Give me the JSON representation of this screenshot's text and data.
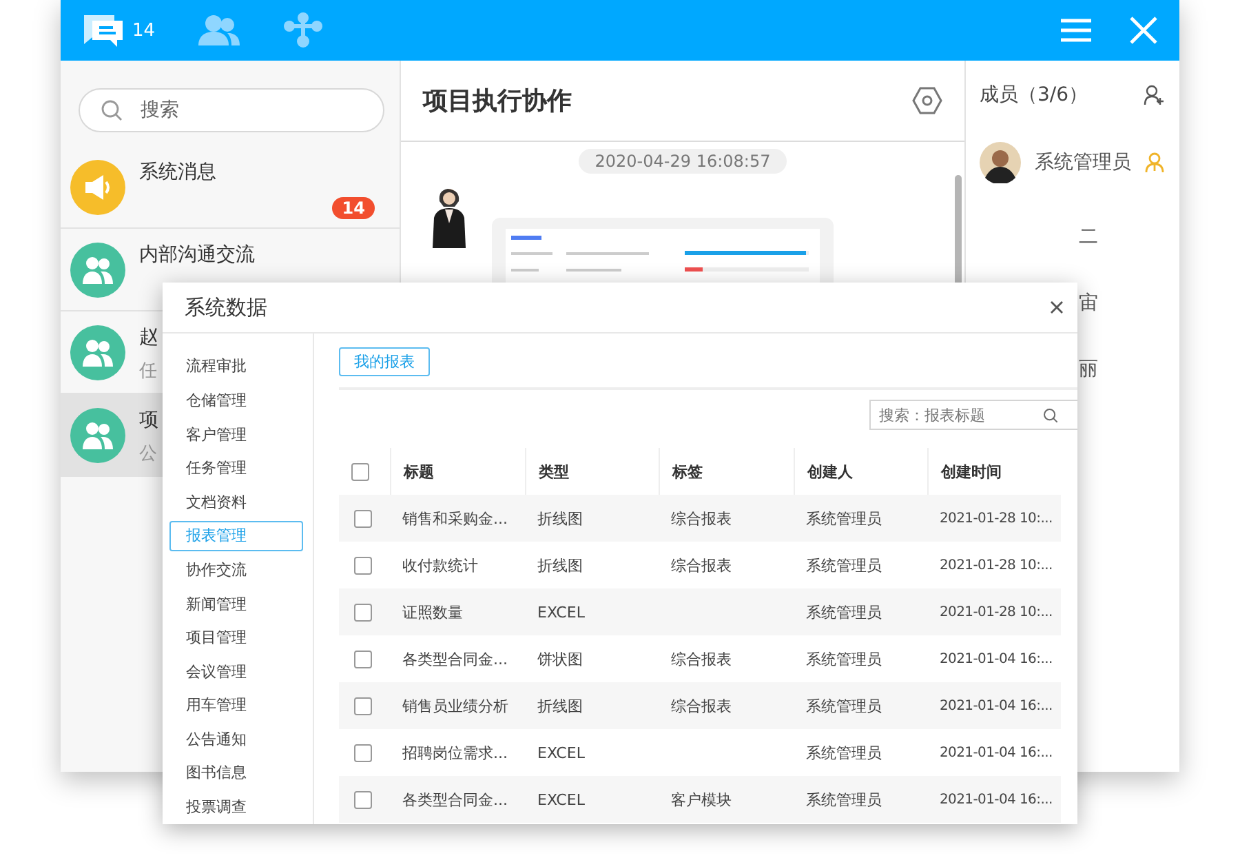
{
  "topbar": {
    "tabs": [
      {
        "kind": "chat",
        "count": "14",
        "selected": true
      },
      {
        "kind": "contacts",
        "selected": false
      },
      {
        "kind": "org",
        "selected": false
      }
    ]
  },
  "search": {
    "placeholder": "搜索"
  },
  "conversations": [
    {
      "kind": "system",
      "name": "系统消息",
      "badge": "14",
      "selected": false
    },
    {
      "kind": "group",
      "name": "内部沟通交流",
      "selected": false
    },
    {
      "kind": "group",
      "name": "赵",
      "preview": "任",
      "selected": false
    },
    {
      "kind": "group",
      "name": "项",
      "preview": "公",
      "selected": true
    }
  ],
  "chat": {
    "title": "项目执行协作",
    "timestamp": "2020-04-29 16:08:57"
  },
  "members": {
    "title": "成员（3/6）",
    "list": [
      {
        "kind": "full",
        "name": "系统管理员",
        "admin": true
      },
      {
        "kind": "cut",
        "name": "二"
      },
      {
        "kind": "cut",
        "name": "宙"
      },
      {
        "kind": "cut",
        "name": "丽"
      }
    ]
  },
  "dialog": {
    "title": "系统数据",
    "nav": [
      {
        "label": "流程审批",
        "selected": false
      },
      {
        "label": "仓储管理",
        "selected": false
      },
      {
        "label": "客户管理",
        "selected": false
      },
      {
        "label": "任务管理",
        "selected": false
      },
      {
        "label": "文档资料",
        "selected": false
      },
      {
        "label": "报表管理",
        "selected": true
      },
      {
        "label": "协作交流",
        "selected": false
      },
      {
        "label": "新闻管理",
        "selected": false
      },
      {
        "label": "项目管理",
        "selected": false
      },
      {
        "label": "会议管理",
        "selected": false
      },
      {
        "label": "用车管理",
        "selected": false
      },
      {
        "label": "公告通知",
        "selected": false
      },
      {
        "label": "图书信息",
        "selected": false
      },
      {
        "label": "投票调查",
        "selected": false
      }
    ],
    "tabs": [
      {
        "label": "我的报表",
        "selected": true
      }
    ],
    "search": {
      "placeholder": "搜索：报表标题"
    },
    "table": {
      "all_checked": false,
      "columns": [
        "标题",
        "类型",
        "标签",
        "创建人",
        "创建时间"
      ],
      "rows": [
        {
          "checked": false,
          "cells": [
            "销售和采购金...",
            "折线图",
            "综合报表",
            "系统管理员",
            "2021-01-28 10:..."
          ]
        },
        {
          "checked": false,
          "cells": [
            "收付款统计",
            "折线图",
            "综合报表",
            "系统管理员",
            "2021-01-28 10:..."
          ]
        },
        {
          "checked": false,
          "cells": [
            "证照数量",
            "EXCEL",
            null,
            "系统管理员",
            "2021-01-28 10:..."
          ]
        },
        {
          "checked": false,
          "cells": [
            "各类型合同金...",
            "饼状图",
            "综合报表",
            "系统管理员",
            "2021-01-04 16:..."
          ]
        },
        {
          "checked": false,
          "cells": [
            "销售员业绩分析",
            "折线图",
            "综合报表",
            "系统管理员",
            "2021-01-04 16:..."
          ]
        },
        {
          "checked": false,
          "cells": [
            "招聘岗位需求...",
            "EXCEL",
            null,
            "系统管理员",
            "2021-01-04 16:..."
          ]
        },
        {
          "checked": false,
          "cells": [
            "各类型合同金...",
            "EXCEL",
            "客户模块",
            "系统管理员",
            "2021-01-04 16:..."
          ]
        }
      ]
    }
  }
}
